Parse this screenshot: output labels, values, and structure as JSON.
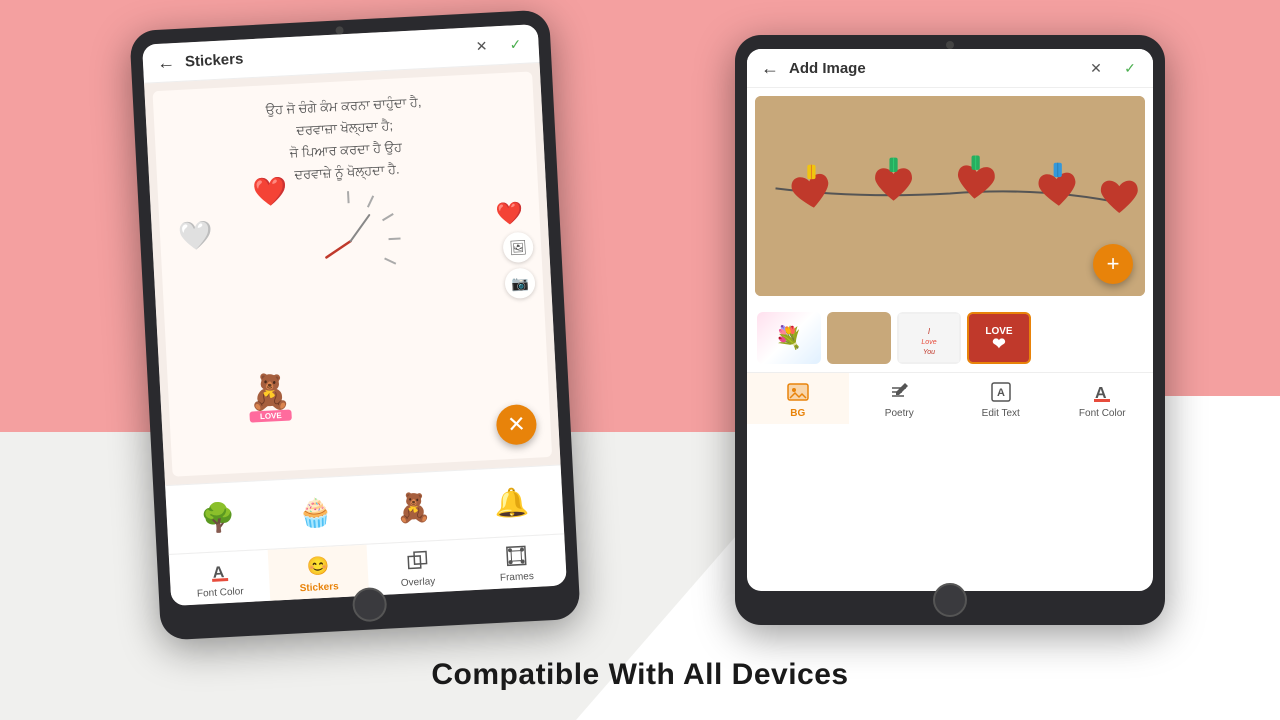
{
  "background": {
    "pink_color": "#f4a0a0",
    "white_color": "#ffffff",
    "light_color": "#f0f0ee"
  },
  "bottom_tagline": "Compatible With All Devices",
  "left_tablet": {
    "header": {
      "back_label": "←",
      "title": "Stickers",
      "close_icon": "✕",
      "check_icon": "✓"
    },
    "canvas": {
      "punjabi_text_line1": "ਉਹ ਜੋ ਚੰਗੇ ਕੰਮ ਕਰਨਾ ਚਾਹੁੰਦਾ ਹੈ,",
      "punjabi_text_line2": "ਦਰਵਾਜ਼ਾ ਖੋਲ੍ਹਦਾ ਹੈ;",
      "punjabi_text_line3": "ਜੋ ਪਿਆਰ ਕਰਦਾ ਹੈ ਉਹ",
      "punjabi_text_line4": "ਦਰਵਾਜ਼ੇ ਨੂੰ ਖੋਲ੍ਹਦਾ ਹੈ."
    },
    "sticker_grid": [
      "🌳",
      "🧁",
      "🧸",
      "🔔"
    ],
    "toolbar": [
      {
        "label": "Font Color",
        "active": false,
        "icon": "A"
      },
      {
        "label": "Stickers",
        "active": true,
        "icon": "😊"
      },
      {
        "label": "Overlay",
        "active": false,
        "icon": "⧉"
      },
      {
        "label": "Frames",
        "active": false,
        "icon": "⊞"
      }
    ]
  },
  "right_tablet": {
    "header": {
      "back_label": "←",
      "title": "Add Image",
      "close_icon": "✕",
      "check_icon": "✓"
    },
    "thumbnails": [
      {
        "type": "flowers",
        "selected": false
      },
      {
        "type": "brown",
        "selected": false
      },
      {
        "type": "text",
        "selected": false
      },
      {
        "type": "love",
        "selected": true
      }
    ],
    "toolbar": [
      {
        "label": "BG",
        "active": true,
        "icon": "🖼"
      },
      {
        "label": "Poetry",
        "active": false,
        "icon": "✏️"
      },
      {
        "label": "Edit Text",
        "active": false,
        "icon": "⊠"
      },
      {
        "label": "Font Color",
        "active": false,
        "icon": "A"
      }
    ]
  }
}
